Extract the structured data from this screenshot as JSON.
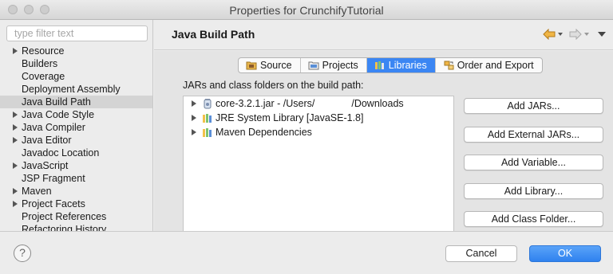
{
  "window": {
    "title": "Properties for CrunchifyTutorial"
  },
  "sidebar": {
    "filter_placeholder": "type filter text",
    "items": [
      {
        "label": "Resource",
        "expandable": true
      },
      {
        "label": "Builders",
        "expandable": false
      },
      {
        "label": "Coverage",
        "expandable": false
      },
      {
        "label": "Deployment Assembly",
        "expandable": false
      },
      {
        "label": "Java Build Path",
        "expandable": false,
        "selected": true
      },
      {
        "label": "Java Code Style",
        "expandable": true
      },
      {
        "label": "Java Compiler",
        "expandable": true
      },
      {
        "label": "Java Editor",
        "expandable": true
      },
      {
        "label": "Javadoc Location",
        "expandable": false
      },
      {
        "label": "JavaScript",
        "expandable": true
      },
      {
        "label": "JSP Fragment",
        "expandable": false
      },
      {
        "label": "Maven",
        "expandable": true
      },
      {
        "label": "Project Facets",
        "expandable": true
      },
      {
        "label": "Project References",
        "expandable": false
      },
      {
        "label": "Refactoring History",
        "expandable": false
      }
    ]
  },
  "main": {
    "title": "Java Build Path",
    "tabs": [
      {
        "label": "Source",
        "icon": "source-folder-icon"
      },
      {
        "label": "Projects",
        "icon": "projects-folder-icon"
      },
      {
        "label": "Libraries",
        "icon": "libraries-icon",
        "active": true
      },
      {
        "label": "Order and Export",
        "icon": "order-export-icon"
      }
    ],
    "section_label": "JARs and class folders on the build path:",
    "entries": [
      {
        "label": "core-3.2.1.jar - /Users/",
        "suffix": "/Downloads",
        "icon": "jar-icon"
      },
      {
        "label": "JRE System Library [JavaSE-1.8]",
        "icon": "library-icon"
      },
      {
        "label": "Maven Dependencies",
        "icon": "library-icon"
      }
    ],
    "buttons": [
      "Add JARs...",
      "Add External JARs...",
      "Add Variable...",
      "Add Library...",
      "Add Class Folder..."
    ]
  },
  "footer": {
    "help_label": "?",
    "cancel_label": "Cancel",
    "ok_label": "OK"
  },
  "colors": {
    "accent": "#3b86f3",
    "selection": "#d4d4d4",
    "nav_arrow": "#e9a83a"
  }
}
